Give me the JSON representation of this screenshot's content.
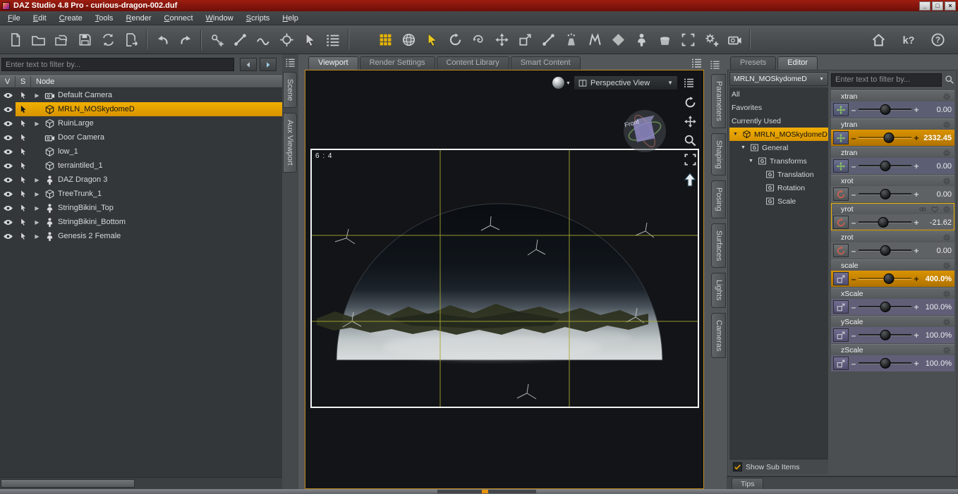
{
  "colors": {
    "accent": "#e8a200",
    "titlebar": "#8e180e",
    "selection": "#f0ae00",
    "slider_fill": "#d99300",
    "pane_border": "#c08a1c"
  },
  "window": {
    "title": "DAZ Studio 4.8 Pro - curious-dragon-002.duf",
    "controls": [
      {
        "name": "minimize",
        "glyph": "_"
      },
      {
        "name": "maximize",
        "glyph": "□"
      },
      {
        "name": "close",
        "glyph": "×"
      }
    ]
  },
  "menubar": {
    "items": [
      "File",
      "Edit",
      "Create",
      "Tools",
      "Render",
      "Connect",
      "Window",
      "Scripts",
      "Help"
    ]
  },
  "toolbar": {
    "groups": [
      [
        {
          "name": "new-file",
          "icon": "page"
        },
        {
          "name": "open-file",
          "icon": "folder"
        },
        {
          "name": "merge-file",
          "icon": "folder-page"
        },
        {
          "name": "save-file",
          "icon": "floppy"
        },
        {
          "name": "refresh-file",
          "icon": "cycle"
        },
        {
          "name": "export-file",
          "icon": "page-arrow"
        }
      ],
      [
        {
          "name": "undo",
          "icon": "undo"
        },
        {
          "name": "redo",
          "icon": "redo"
        }
      ],
      [
        {
          "name": "create-node",
          "icon": "node-plus"
        },
        {
          "name": "joint-editor",
          "icon": "bone"
        },
        {
          "name": "weight-brush",
          "icon": "wave"
        },
        {
          "name": "node-settings",
          "icon": "target-gear"
        },
        {
          "name": "pointer-tool",
          "icon": "cursor"
        },
        {
          "name": "scene-list",
          "icon": "list"
        }
      ],
      [
        {
          "name": "render",
          "icon": "grid",
          "tint": "#e8b400"
        },
        {
          "name": "draw-style",
          "icon": "sphere",
          "tint": "#d6d9da"
        },
        {
          "name": "node-selection-tool",
          "icon": "cursor",
          "tint": "#e8c71f"
        },
        {
          "name": "rotate-tool",
          "icon": "orbit"
        },
        {
          "name": "twist-tool",
          "icon": "spiral"
        },
        {
          "name": "translate-tool",
          "icon": "cross-arrows"
        },
        {
          "name": "scale-tool",
          "icon": "scale3d"
        },
        {
          "name": "active-pose-tool",
          "icon": "bone"
        },
        {
          "name": "surface-selection-tool",
          "icon": "spray"
        },
        {
          "name": "geometry-editor-tool",
          "icon": "poly-m"
        },
        {
          "name": "node-editor",
          "icon": "diamond"
        },
        {
          "name": "figure",
          "icon": "person"
        },
        {
          "name": "primitive",
          "icon": "pot"
        },
        {
          "name": "spot-render-tool",
          "icon": "corners"
        },
        {
          "name": "preferences",
          "icon": "gear-plus"
        },
        {
          "name": "new-camera",
          "icon": "camera"
        }
      ],
      [
        {
          "name": "daz-connect",
          "icon": "home"
        },
        {
          "name": "whats-this",
          "icon": "what-is"
        },
        {
          "name": "help",
          "icon": "help"
        }
      ]
    ]
  },
  "scene_panel": {
    "filter": {
      "placeholder": "Enter text to filter by..."
    },
    "header": {
      "v": "V",
      "s": "S",
      "node": "Node"
    },
    "nodes": [
      {
        "label": "Default Camera",
        "icon": "camera",
        "expandable": true,
        "selected": false
      },
      {
        "label": "MRLN_MOSkydomeD",
        "icon": "prop-cube",
        "expandable": false,
        "selected": true
      },
      {
        "label": "RuinLarge",
        "icon": "prop-cube",
        "expandable": true,
        "selected": false
      },
      {
        "label": "Door Camera",
        "icon": "camera",
        "expandable": false,
        "selected": false
      },
      {
        "label": "low_1",
        "icon": "prop-cube",
        "expandable": false,
        "selected": false
      },
      {
        "label": "terraintiled_1",
        "icon": "prop-cube",
        "expandable": false,
        "selected": false
      },
      {
        "label": "DAZ Dragon 3",
        "icon": "figure",
        "expandable": true,
        "selected": false
      },
      {
        "label": "TreeTrunk_1",
        "icon": "prop-cube",
        "expandable": true,
        "selected": false
      },
      {
        "label": "StringBikini_Top",
        "icon": "figure",
        "expandable": true,
        "selected": false
      },
      {
        "label": "StringBikini_Bottom",
        "icon": "figure",
        "expandable": true,
        "selected": false
      },
      {
        "label": "Genesis 2 Female",
        "icon": "figure",
        "expandable": true,
        "selected": false
      }
    ],
    "side_tabs": [
      "Scene",
      "Aux Viewport"
    ]
  },
  "viewport": {
    "tabs": [
      "Viewport",
      "Render Settings",
      "Content Library",
      "Smart Content"
    ],
    "active_tab": "Viewport",
    "view_menu": {
      "label": "Perspective View"
    },
    "aspect_label": "6 : 4",
    "nav_cube": {
      "front_label": "Front"
    },
    "controls": [
      {
        "name": "orbit-control",
        "icon": "orbit"
      },
      {
        "name": "pan-control",
        "icon": "cross-arrows"
      },
      {
        "name": "zoom-control",
        "icon": "magnifier"
      },
      {
        "name": "frame-control",
        "icon": "corners"
      },
      {
        "name": "reset-view-control",
        "icon": "arrow-up"
      }
    ],
    "side_tabs": [
      "Parameters",
      "Shaping",
      "Posing",
      "Surfaces",
      "Lights",
      "Cameras"
    ]
  },
  "parameters_panel": {
    "tabs": [
      "Presets",
      "Editor"
    ],
    "active_tab": "Editor",
    "node_selector": "MRLN_MOSkydomeD",
    "groups": [
      {
        "label": "All",
        "indent": 0
      },
      {
        "label": "Favorites",
        "indent": 0
      },
      {
        "label": "Currently Used",
        "indent": 0
      },
      {
        "label": "MRLN_MOSkydomeD",
        "indent": 0,
        "selected": true,
        "expanded": true,
        "icon": "prop-cube"
      },
      {
        "label": "General",
        "indent": 1,
        "expanded": true,
        "icon": "group"
      },
      {
        "label": "Transforms",
        "indent": 2,
        "expanded": true,
        "icon": "group"
      },
      {
        "label": "Translation",
        "indent": 3,
        "icon": "group"
      },
      {
        "label": "Rotation",
        "indent": 3,
        "icon": "group"
      },
      {
        "label": "Scale",
        "indent": 3,
        "icon": "group"
      }
    ],
    "filter": {
      "placeholder": "Enter text to filter by..."
    },
    "sliders": [
      {
        "name": "xtran",
        "value": "0.00",
        "type": "translate",
        "position": 50,
        "filled": false,
        "selected": false
      },
      {
        "name": "ytran",
        "value": "2332.45",
        "type": "translate",
        "position": 57,
        "filled": true,
        "selected": false
      },
      {
        "name": "ztran",
        "value": "0.00",
        "type": "translate",
        "position": 50,
        "filled": false,
        "selected": false
      },
      {
        "name": "xrot",
        "value": "0.00",
        "type": "rotate",
        "position": 50,
        "filled": false,
        "selected": false
      },
      {
        "name": "yrot",
        "value": "-21.62",
        "type": "rotate",
        "position": 46,
        "filled": false,
        "selected": true
      },
      {
        "name": "zrot",
        "value": "0.00",
        "type": "rotate",
        "position": 50,
        "filled": false,
        "selected": false
      },
      {
        "name": "scale",
        "value": "400.0%",
        "type": "scale",
        "position": 57,
        "filled": true,
        "selected": false
      },
      {
        "name": "xScale",
        "value": "100.0%",
        "type": "scale",
        "position": 50,
        "filled": false,
        "selected": false
      },
      {
        "name": "yScale",
        "value": "100.0%",
        "type": "scale",
        "position": 50,
        "filled": false,
        "selected": false
      },
      {
        "name": "zScale",
        "value": "100.0%",
        "type": "scale",
        "position": 50,
        "filled": false,
        "selected": false
      }
    ],
    "show_sub_items": {
      "label": "Show Sub Items",
      "checked": true
    },
    "tips_label": "Tips"
  }
}
